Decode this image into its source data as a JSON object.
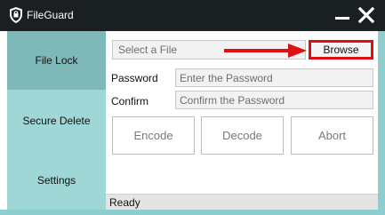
{
  "window": {
    "title": "FileGuard",
    "app_icon": "shield-icon",
    "minimize_icon": "minimize-icon",
    "close_icon": "close-icon"
  },
  "sidebar": {
    "items": [
      {
        "label": "File Lock",
        "selected": true
      },
      {
        "label": "Secure Delete",
        "selected": false
      },
      {
        "label": "Settings",
        "selected": false
      }
    ]
  },
  "file": {
    "placeholder": "Select a File",
    "value": "",
    "browse_label": "Browse"
  },
  "password": {
    "label": "Password",
    "placeholder": "Enter the Password",
    "value": ""
  },
  "confirm": {
    "label": "Confirm",
    "placeholder": "Confirm the Password",
    "value": ""
  },
  "actions": {
    "encode": "Encode",
    "decode": "Decode",
    "abort": "Abort"
  },
  "status": {
    "text": "Ready"
  },
  "annotation": {
    "arrow_icon": "right-arrow-icon",
    "highlight_color": "#dd1111"
  },
  "colors": {
    "titlebar": "#1a1f22",
    "sidebar": "#8ecece",
    "sidebar_selected": "#7fb8b8",
    "accent": "#dd1111"
  }
}
